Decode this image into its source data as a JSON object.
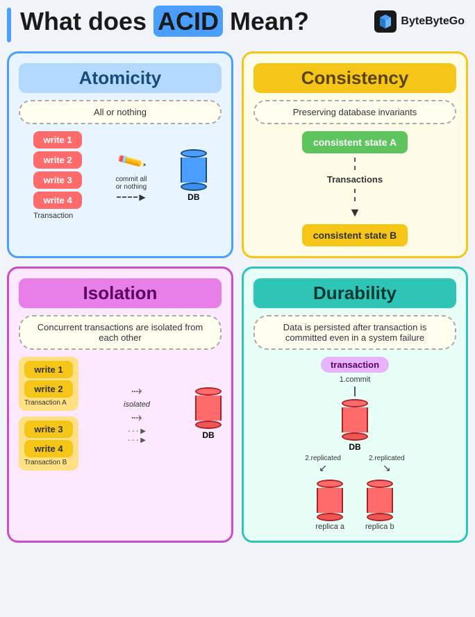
{
  "header": {
    "title_prefix": "What does ",
    "title_acid": "ACID",
    "title_suffix": " Mean?",
    "logo_name": "ByteByteGo"
  },
  "atomicity": {
    "title": "Atomicity",
    "desc": "All or nothing",
    "writes": [
      "write 1",
      "write 2",
      "write 3",
      "write 4"
    ],
    "transaction_label": "Transaction",
    "commit_label": "commit all\nor nothing",
    "db_label": "DB"
  },
  "consistency": {
    "title": "Consistency",
    "desc": "Preserving database invariants",
    "state_a": "consistent state A",
    "transactions_label": "Transactions",
    "state_b": "consistent state B"
  },
  "isolation": {
    "title": "Isolation",
    "desc": "Concurrent transactions are isolated from each other",
    "group_a_writes": [
      "write 1",
      "write 2"
    ],
    "group_a_label": "Transaction A",
    "group_b_writes": [
      "write 3",
      "write 4"
    ],
    "group_b_label": "Transaction B",
    "isolated_label": "isolated",
    "db_label": "DB"
  },
  "durability": {
    "title": "Durability",
    "desc": "Data is persisted after transaction is committed even in a system failure",
    "transaction_label": "transaction",
    "commit_label": "1.commit",
    "db_label": "DB",
    "replicated_label": "2.replicated",
    "replica_a_label": "replica a",
    "replica_b_label": "replica b"
  }
}
